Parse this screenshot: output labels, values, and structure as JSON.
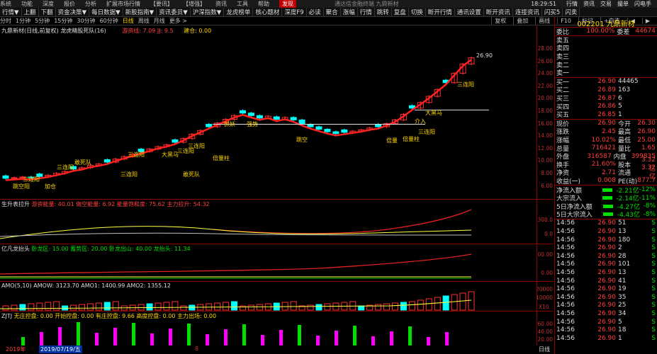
{
  "topmenu": {
    "items": [
      "系统",
      "功能",
      "深度",
      "报价",
      "分析",
      "扩展市场行情",
      "【要讯】",
      "【增强】",
      "资讯",
      "工具",
      "帮助",
      "发现"
    ],
    "center": "通达信金融终端 九鼎新材",
    "time": "18:29:51",
    "right": [
      "行情",
      "资讯",
      "交易",
      "撮单",
      "闪电手"
    ]
  },
  "toolbar": {
    "items": [
      "行情▼",
      "上翻",
      "下翻",
      "资金决策▼",
      "每日数据▼",
      "新股指南▼",
      "资讯委员▼",
      "沪深指数▼",
      "龙虎榜单",
      "核心题材",
      "深度F9",
      "必读",
      "聚合",
      "涨幅",
      "行情",
      "跳转",
      "复盘",
      "切换",
      "断开行情",
      "通讯设置",
      "断开资讯",
      "连接资讯",
      "闪买5",
      "闪卖"
    ]
  },
  "tabs": {
    "items": [
      "分时",
      "1分钟",
      "5分钟",
      "15分钟",
      "30分钟",
      "60分钟",
      "日线",
      "周线",
      "月线",
      "更多 >"
    ],
    "right": [
      "复权",
      "叠加",
      "画线",
      "F10",
      "标记",
      "+自选",
      "◀",
      "▶"
    ]
  },
  "main": {
    "title": "九鼎新材(日线,前复权) 龙虎精股死队(16)",
    "formula": "游资线: 7.09  JJ: 9.5",
    "jc": "建仓: 0.00",
    "ticks": [
      "28.00",
      "26.00",
      "24.00",
      "22.00",
      "20.00",
      "18.00",
      "16.00",
      "14.00",
      "12.00",
      "10.00",
      "8.00",
      "6.00"
    ],
    "peak": "26.90",
    "labels": [
      "三连阳",
      "跳空阳",
      "三连阳",
      "敢死队",
      "三连阳",
      "三连阳",
      "大黑马",
      "三连阳",
      "敢死队",
      "三连阳",
      "加仓",
      "抓妖",
      "强势",
      "跳空",
      "倍量",
      "介入",
      "三连阳",
      "大黑马",
      "三连阳",
      "倍量柱",
      "倍量柱"
    ]
  },
  "p2": {
    "title": "生升表拉升",
    "vals": "游资能量: 40.01  做空能量: 6.92  能量饱和度: 75.62  主力拉升: 54.32",
    "t1": "300.0",
    "t2": "0.0"
  },
  "p3": {
    "title": "亿凡龙抬头",
    "vals": "卧龙区: 15.00  蓄势区: 20.00  卧龙出山: 40.00  龙抬头: 11.34",
    "t1": "500.00",
    "t2": "0.00"
  },
  "p4": {
    "title": "AMO(5,10)",
    "vals": "AMOW: 3123.70  AMO1: 1400.99  AMO2: 1355.12",
    "t1": "20000",
    "t2": "10000",
    "t3": "X10"
  },
  "p5": {
    "title": "ZJTJ",
    "vals": "无庄控盘: 0.00  开始控盘: 0.00  有庄控盘: 9.66  高度控盘: 0.00  主力出场: 0.00",
    "t1": "60.00",
    "t2": "40.00",
    "t3": "20.00"
  },
  "bottom": {
    "year": "2019年",
    "date": "2019/07/19/五",
    "mid": "8",
    "right": "日线"
  },
  "quote": {
    "code": "002201",
    "name": "九鼎新材",
    "weibi": {
      "l": "委比",
      "v": "100.00%",
      "l2": "委差",
      "v2": "44674"
    },
    "asks": [
      {
        "l": "卖五",
        "p": "",
        "v": ""
      },
      {
        "l": "卖四",
        "p": "",
        "v": ""
      },
      {
        "l": "卖三",
        "p": "",
        "v": ""
      },
      {
        "l": "卖二",
        "p": "",
        "v": ""
      },
      {
        "l": "卖一",
        "p": "",
        "v": ""
      }
    ],
    "bids": [
      {
        "l": "买一",
        "p": "26.90",
        "v": "44465"
      },
      {
        "l": "买二",
        "p": "26.89",
        "v": "163"
      },
      {
        "l": "买三",
        "p": "26.87",
        "v": "6"
      },
      {
        "l": "买四",
        "p": "26.86",
        "v": "5"
      },
      {
        "l": "买五",
        "p": "26.85",
        "v": "1"
      }
    ],
    "stats": [
      [
        "现价",
        "26.90",
        "今开",
        "26.30"
      ],
      [
        "涨跌",
        "2.45",
        "最高",
        "26.90"
      ],
      [
        "涨幅",
        "10.02%",
        "最低",
        "25.00"
      ],
      [
        "总量",
        "716421",
        "量比",
        "1.65"
      ],
      [
        "外盘",
        "316587",
        "内盘",
        "399835"
      ],
      [
        "换手",
        "21.60%",
        "股本",
        "3.32亿"
      ],
      [
        "净资",
        "2.71",
        "流通",
        "3.32亿"
      ],
      [
        "收益(一)",
        "0.008",
        "PE(动)",
        "877.7"
      ]
    ],
    "flows": [
      [
        "净流入额",
        "-2.21亿",
        "-12%"
      ],
      [
        "大宗流入",
        "-2.14亿",
        "-11%"
      ],
      [
        "5日净流入额",
        "-4.27亿",
        "-8%"
      ],
      [
        "5日大宗流入",
        "-4.43亿",
        "-8%"
      ]
    ],
    "ticks": [
      [
        "14:56",
        "26.90",
        "51",
        "S"
      ],
      [
        "14:56",
        "26.90",
        "13",
        "S"
      ],
      [
        "14:56",
        "26.90",
        "180",
        "S"
      ],
      [
        "14:56",
        "26.90",
        "2",
        "S"
      ],
      [
        "14:56",
        "26.90",
        "28",
        "S"
      ],
      [
        "14:56",
        "26.90",
        "101",
        "S"
      ],
      [
        "14:56",
        "26.90",
        "13",
        "S"
      ],
      [
        "14:56",
        "26.90",
        "41",
        "S"
      ],
      [
        "14:56",
        "26.90",
        "19",
        "S"
      ],
      [
        "14:56",
        "26.90",
        "35",
        "S"
      ],
      [
        "14:56",
        "26.90",
        "25",
        "S"
      ],
      [
        "14:56",
        "26.90",
        "34",
        "S"
      ],
      [
        "14:56",
        "26.90",
        "5",
        "S"
      ],
      [
        "14:56",
        "26.90",
        "18",
        "S"
      ],
      [
        "14:56",
        "26.90",
        "1",
        "S"
      ]
    ]
  },
  "colors": {
    "up": "#ff3030",
    "down": "#00ffff",
    "yellow": "#ffd700",
    "red_line": "#e02020",
    "green_line": "#00c000"
  }
}
